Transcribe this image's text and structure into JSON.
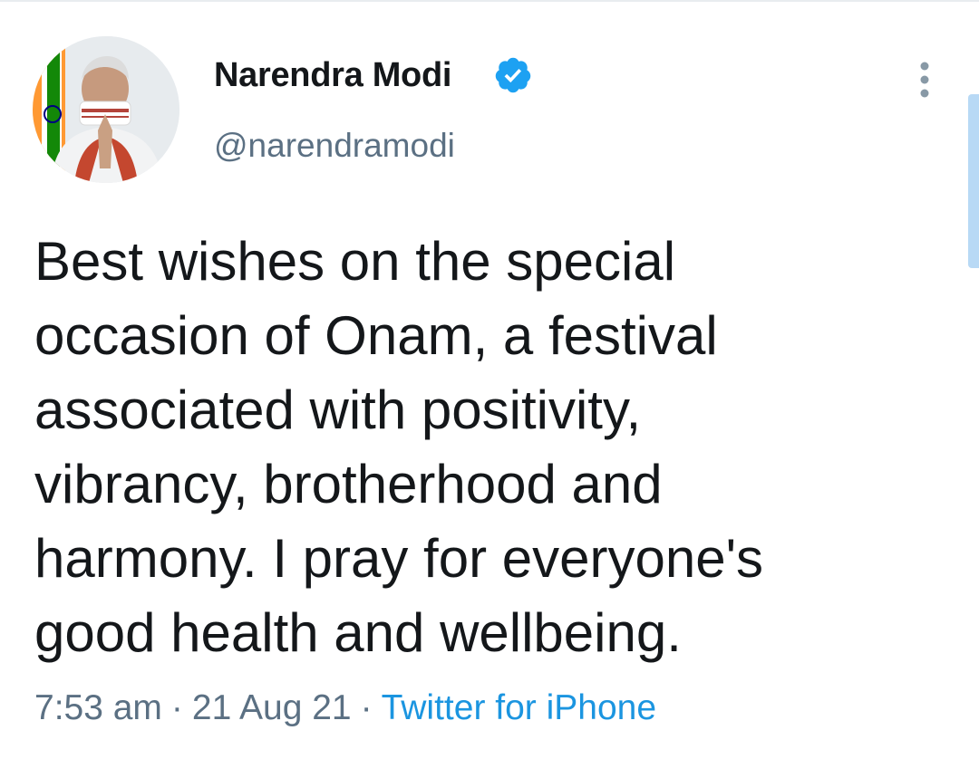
{
  "tweet": {
    "author": {
      "display_name": "Narendra Modi",
      "handle": "@narendramodi",
      "verified": true
    },
    "text_lines": [
      "Best wishes on the special",
      "occasion of Onam, a festival",
      "associated with positivity,",
      "vibrancy, brotherhood and",
      "harmony. I pray for everyone's",
      "good health and wellbeing."
    ],
    "time": "7:53 am",
    "separator": "·",
    "date": "21 Aug 21",
    "source": "Twitter for iPhone"
  },
  "icons": {
    "verified": "verified-badge-icon",
    "more": "vertical-ellipsis-icon"
  },
  "colors": {
    "accent": "#1b95e0",
    "verified_badge": "#1da1f2",
    "text": "#14171a",
    "secondary_text": "#5b7083",
    "scroll_indicator": "#b8d9f5"
  }
}
